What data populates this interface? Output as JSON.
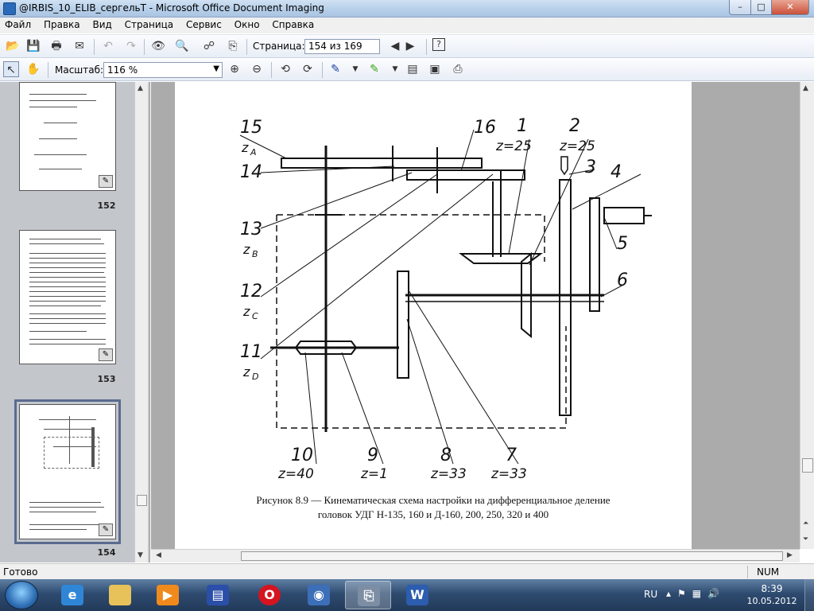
{
  "window": {
    "title": "@IRBIS_10_ELIB_сергельТ - Microsoft Office Document Imaging",
    "minimize": "–",
    "maximize": "□",
    "close": "✕"
  },
  "menu": [
    "Файл",
    "Правка",
    "Вид",
    "Страница",
    "Сервис",
    "Окно",
    "Справка"
  ],
  "toolbar1": {
    "page_label": "Страница:",
    "page_value": "154 из 169",
    "icons": [
      "open-icon",
      "save-icon",
      "print-icon",
      "send-icon",
      "undo-icon",
      "redo-icon",
      "reading-view-icon",
      "find-icon",
      "ocr-icon",
      "prev-page-icon",
      "next-page-icon",
      "help-icon"
    ]
  },
  "toolbar2": {
    "zoom_label": "Масштаб:",
    "zoom_value": "116 %",
    "icons": [
      "select-pointer-icon",
      "hand-pan-icon",
      "zoom-in-icon",
      "zoom-out-icon",
      "rotate-left-icon",
      "rotate-right-icon",
      "pen-icon",
      "highlighter-icon",
      "text-box-icon",
      "picture-icon",
      "send-ocr-icon"
    ]
  },
  "thumbnails": [
    {
      "page": "152",
      "selected": false
    },
    {
      "page": "153",
      "selected": false
    },
    {
      "page": "154",
      "selected": true
    }
  ],
  "diagram": {
    "labels": {
      "n15": "15",
      "zA": "z",
      "zA_sub": "A",
      "n14": "14",
      "n16": "16",
      "n1": "1",
      "z1": "z=25",
      "n2": "2",
      "z2": "z=25",
      "n3": "3",
      "n4": "4",
      "n5": "5",
      "n6": "6",
      "n13": "13",
      "zB": "z",
      "zB_sub": "B",
      "n12": "12",
      "zC": "z",
      "zC_sub": "C",
      "n11": "11",
      "zD": "z",
      "zD_sub": "D",
      "n10": "10",
      "z10": "z=40",
      "n9": "9",
      "z9": "z=1",
      "n8": "8",
      "z8": "z=33",
      "n7": "7",
      "z7": "z=33"
    },
    "caption_line1": "Рисунок 8.9 — Кинематическая схема настройки на дифференциальное деление",
    "caption_line2": "головок УДГ Н-135, 160 и Д-160, 200, 250, 320 и 400"
  },
  "statusbar": {
    "text": "Готово",
    "num": "NUM"
  },
  "taskbar": {
    "apps": [
      "ie-icon",
      "explorer-icon",
      "media-player-icon",
      "save-app-icon",
      "opera-icon",
      "irfan-icon",
      "doc-imaging-icon",
      "word-icon"
    ],
    "lang": "RU",
    "time": "8:39",
    "date": "10.05.2012"
  }
}
